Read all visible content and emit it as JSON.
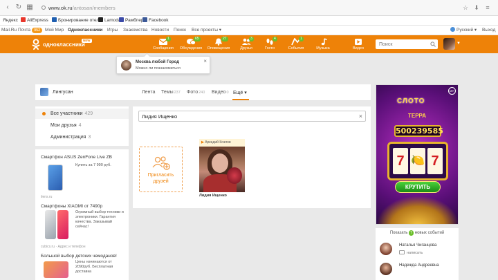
{
  "browser": {
    "url_host": "www.ok.ru",
    "url_path": "/antosan/members",
    "bookmarks": [
      "Яндекс",
      "AliExpress",
      "Бронирование отел",
      "Lamoda",
      "Рамблер",
      "Facebook"
    ]
  },
  "top_strip": {
    "items": [
      "Mail.Ru",
      "Почта",
      "Мой Мир",
      "Одноклассники",
      "Игры",
      "Знакомства",
      "Новости",
      "Поиск",
      "Все проекты ▾"
    ],
    "mail_badge": "952",
    "language": "Русский ▾",
    "exit": "Выход"
  },
  "header": {
    "logo_text": "одноклассники",
    "logo_badge": "NEW",
    "nav": [
      {
        "label": "Сообщения",
        "count": "1"
      },
      {
        "label": "Обсуждения",
        "count": "65"
      },
      {
        "label": "Оповещения",
        "count": "27"
      },
      {
        "label": "Друзья",
        "count": "3"
      },
      {
        "label": "Гости",
        "count": "4"
      },
      {
        "label": "События",
        "count": "1"
      },
      {
        "label": "Музыка",
        "count": ""
      },
      {
        "label": "Видео",
        "count": ""
      }
    ],
    "search_placeholder": "Поиск"
  },
  "notification": {
    "title": "Москва любой Город",
    "text": "Можно ли познакомиться"
  },
  "group": {
    "name": "Лингусан",
    "tabs": [
      {
        "label": "Лента",
        "count": ""
      },
      {
        "label": "Темы",
        "count": "237"
      },
      {
        "label": "Фото",
        "count": "240"
      },
      {
        "label": "Видео",
        "count": "0"
      },
      {
        "label": "Ещё ▾",
        "count": ""
      }
    ]
  },
  "left_menu": [
    {
      "label": "Все участники",
      "count": "429"
    },
    {
      "label": "Мои друзья",
      "count": "4"
    },
    {
      "label": "Администрация",
      "count": "3"
    }
  ],
  "members": {
    "search_value": "Лидия Ищенко",
    "invite_label": "Пригласить друзей",
    "card": {
      "tag_prefix": "▶",
      "tag_text": "Аркадий Козлов",
      "name": "Лидия Ищенко"
    }
  },
  "ads": [
    {
      "title": "Смартфон ASUS ZenFone Live ZB",
      "text": "Купить за 7 990 руб.",
      "source": "tiens.ru"
    },
    {
      "title": "Смартфоны XIAOMI от 7490р",
      "text": "Огромный выбор техники и электроники. Гарантия качества. Заказывай сейчас!",
      "source": "cubics.ru · Адрес и телефон"
    },
    {
      "title": "Большой выбор детских чемоданов!",
      "text": "Цены начинаются от 2090руб. Бесплатная доставка",
      "source": ""
    }
  ],
  "casino": {
    "logo_line1": "СЛОТО",
    "logo_line2": "ТЕРРА",
    "jackpot": "500239585",
    "reels": [
      "7",
      "🍋",
      "7"
    ],
    "button": "КРУТИТЬ",
    "age": "18+"
  },
  "events": {
    "prefix": "Показать",
    "count": "7",
    "suffix": "новых событий",
    "people": [
      {
        "name": "Наталья Чиганцова",
        "action": "написать"
      },
      {
        "name": "Надежда Андреевна",
        "action": ""
      }
    ]
  }
}
